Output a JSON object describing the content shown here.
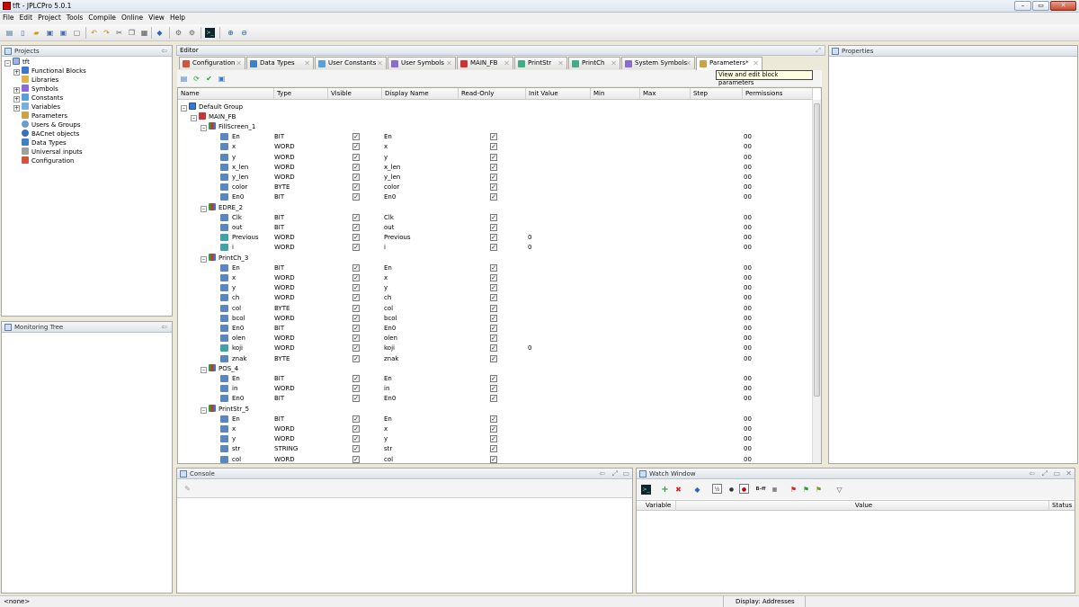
{
  "window": {
    "title": "tft - JPLCPro 5.0.1"
  },
  "menu": [
    "File",
    "Edit",
    "Project",
    "Tools",
    "Compile",
    "Online",
    "View",
    "Help"
  ],
  "projects": {
    "title": "Projects",
    "root": "tft",
    "items": [
      "Functional Blocks",
      "Libraries",
      "Symbols",
      "Constants",
      "Variables",
      "Parameters",
      "Users & Groups",
      "BACnet objects",
      "Data Types",
      "Universal inputs",
      "Configuration"
    ]
  },
  "monitoring": {
    "title": "Monitoring Tree"
  },
  "editor": {
    "title": "Editor",
    "tabs": [
      "Configuration",
      "Data Types",
      "User Constants",
      "User Symbols",
      "MAIN_FB",
      "PrintStr",
      "PrintCh",
      "System Symbols",
      "Parameters*"
    ],
    "tooltip": "View and edit block parameters",
    "columns": [
      "Name",
      "Type",
      "Visible",
      "Display Name",
      "Read-Only",
      "Init Value",
      "Min",
      "Max",
      "Step",
      "Permissions"
    ],
    "group": "Default Group",
    "main_block": "MAIN_FB",
    "blocks": [
      {
        "name": "FillScreen_1",
        "params": [
          {
            "name": "En",
            "type": "BIT",
            "display": "En",
            "init": "",
            "perm": "00"
          },
          {
            "name": "x",
            "type": "WORD",
            "display": "x",
            "init": "",
            "perm": "00"
          },
          {
            "name": "y",
            "type": "WORD",
            "display": "y",
            "init": "",
            "perm": "00"
          },
          {
            "name": "x_len",
            "type": "WORD",
            "display": "x_len",
            "init": "",
            "perm": "00"
          },
          {
            "name": "y_len",
            "type": "WORD",
            "display": "y_len",
            "init": "",
            "perm": "00"
          },
          {
            "name": "color",
            "type": "BYTE",
            "display": "color",
            "init": "",
            "perm": "00"
          },
          {
            "name": "En0",
            "type": "BIT",
            "display": "En0",
            "init": "",
            "perm": "00"
          }
        ]
      },
      {
        "name": "EDRE_2",
        "params": [
          {
            "name": "Clk",
            "type": "BIT",
            "display": "Clk",
            "init": "",
            "perm": "00"
          },
          {
            "name": "out",
            "type": "BIT",
            "display": "out",
            "init": "",
            "perm": "00"
          },
          {
            "name": "Previous",
            "type": "WORD",
            "display": "Previous",
            "init": "0",
            "perm": "00"
          },
          {
            "name": "i",
            "type": "WORD",
            "display": "i",
            "init": "0",
            "perm": "00"
          }
        ]
      },
      {
        "name": "PrintCh_3",
        "params": [
          {
            "name": "En",
            "type": "BIT",
            "display": "En",
            "init": "",
            "perm": "00"
          },
          {
            "name": "x",
            "type": "WORD",
            "display": "x",
            "init": "",
            "perm": "00"
          },
          {
            "name": "y",
            "type": "WORD",
            "display": "y",
            "init": "",
            "perm": "00"
          },
          {
            "name": "ch",
            "type": "WORD",
            "display": "ch",
            "init": "",
            "perm": "00"
          },
          {
            "name": "col",
            "type": "BYTE",
            "display": "col",
            "init": "",
            "perm": "00"
          },
          {
            "name": "bcol",
            "type": "WORD",
            "display": "bcol",
            "init": "",
            "perm": "00"
          },
          {
            "name": "En0",
            "type": "BIT",
            "display": "En0",
            "init": "",
            "perm": "00"
          },
          {
            "name": "olen",
            "type": "WORD",
            "display": "olen",
            "init": "",
            "perm": "00"
          },
          {
            "name": "koji",
            "type": "WORD",
            "display": "koji",
            "init": "0",
            "perm": "00"
          },
          {
            "name": "znak",
            "type": "BYTE",
            "display": "znak",
            "init": "",
            "perm": "00"
          }
        ]
      },
      {
        "name": "POS_4",
        "params": [
          {
            "name": "En",
            "type": "BIT",
            "display": "En",
            "init": "",
            "perm": "00"
          },
          {
            "name": "in",
            "type": "WORD",
            "display": "in",
            "init": "",
            "perm": "00"
          },
          {
            "name": "En0",
            "type": "BIT",
            "display": "En0",
            "init": "",
            "perm": "00"
          }
        ]
      },
      {
        "name": "PrintStr_5",
        "params": [
          {
            "name": "En",
            "type": "BIT",
            "display": "En",
            "init": "",
            "perm": "00"
          },
          {
            "name": "x",
            "type": "WORD",
            "display": "x",
            "init": "",
            "perm": "00"
          },
          {
            "name": "y",
            "type": "WORD",
            "display": "y",
            "init": "",
            "perm": "00"
          },
          {
            "name": "str",
            "type": "STRING",
            "display": "str",
            "init": "",
            "perm": "00"
          },
          {
            "name": "col",
            "type": "WORD",
            "display": "col",
            "init": "",
            "perm": "00"
          }
        ]
      }
    ]
  },
  "properties": {
    "title": "Properties"
  },
  "console": {
    "title": "Console"
  },
  "watch": {
    "title": "Watch Window",
    "columns": [
      "Variable",
      "Value",
      "Status"
    ],
    "bff": "B-ff"
  },
  "status": {
    "left": "<none>",
    "display": "Display: Addresses"
  }
}
